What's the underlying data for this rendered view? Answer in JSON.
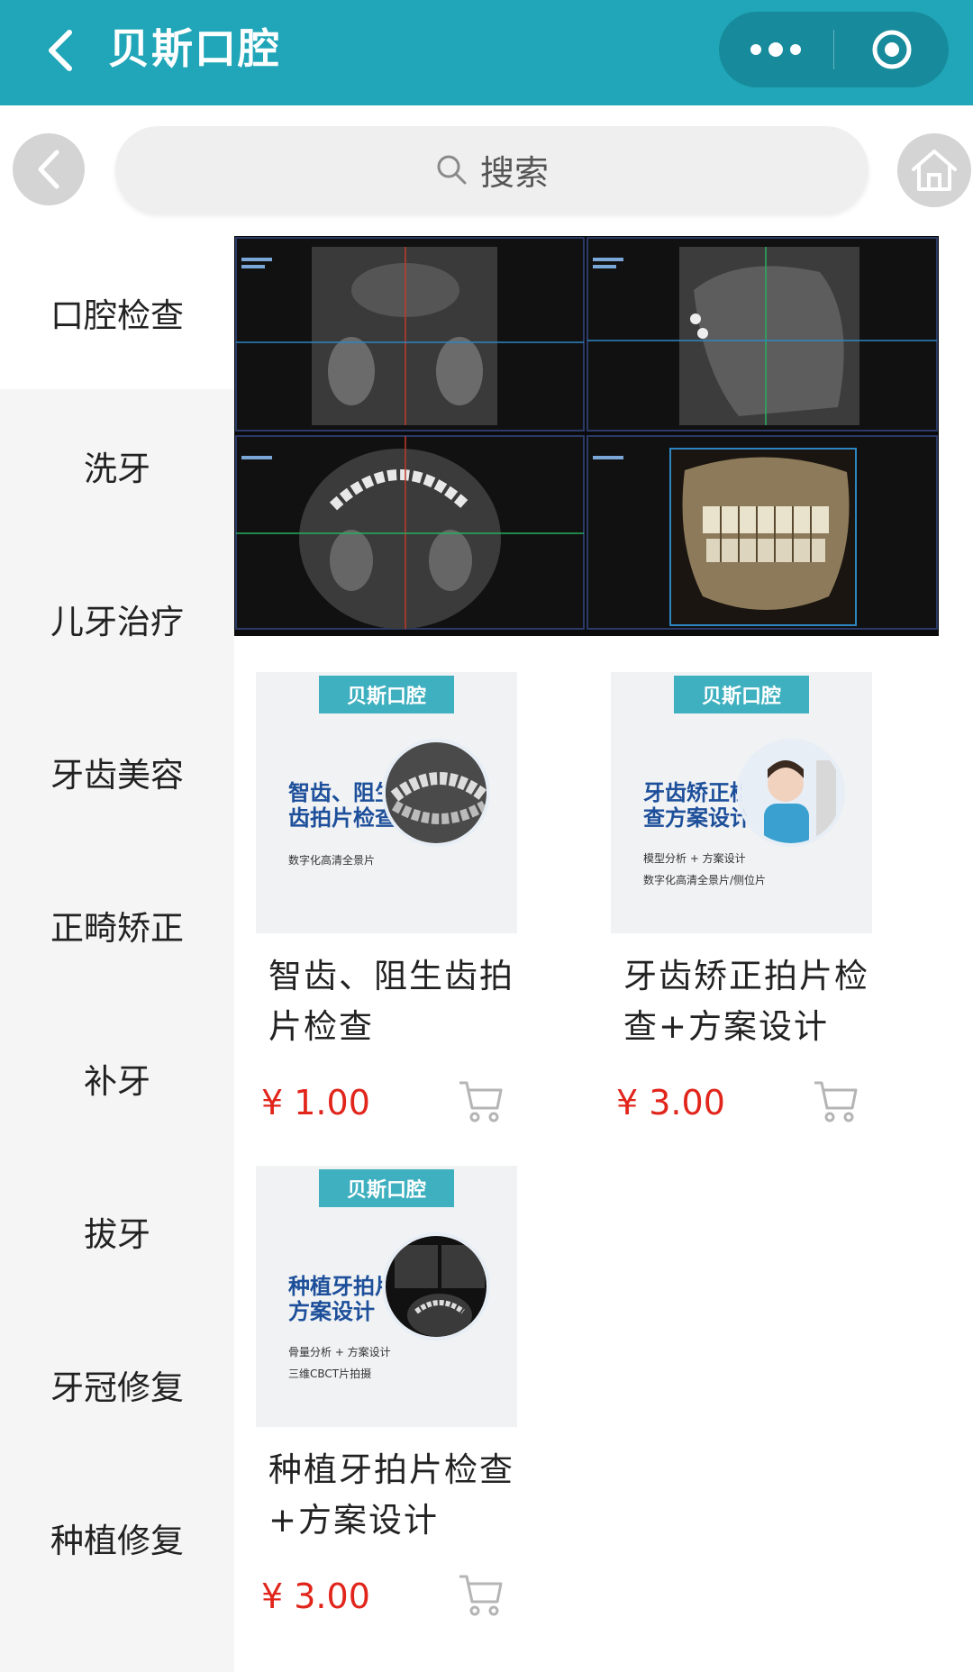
{
  "header": {
    "title": "贝斯口腔"
  },
  "search": {
    "placeholder": "搜索"
  },
  "sidebar": {
    "items": [
      {
        "label": "口腔检查",
        "active": true
      },
      {
        "label": "洗牙"
      },
      {
        "label": "儿牙治疗"
      },
      {
        "label": "牙齿美容"
      },
      {
        "label": "正畸矫正"
      },
      {
        "label": "补牙"
      },
      {
        "label": "拔牙"
      },
      {
        "label": "牙冠修复"
      },
      {
        "label": "种植修复"
      }
    ]
  },
  "products": [
    {
      "name": "智齿、阻生齿拍片检查",
      "price": "¥ 1.00",
      "thumb": {
        "brand": "贝斯口腔",
        "headline": "智齿、阻生齿拍片检查",
        "checks": [
          "数字化高清全景片"
        ]
      }
    },
    {
      "name": "牙齿矫正拍片检查+方案设计",
      "price": "¥ 3.00",
      "thumb": {
        "brand": "贝斯口腔",
        "headline": "牙齿矫正检查方案设计",
        "checks": [
          "模型分析 + 方案设计",
          "数字化高清全景片/侧位片"
        ]
      }
    },
    {
      "name": "种植牙拍片检查+方案设计",
      "price": "¥ 3.00",
      "thumb": {
        "brand": "贝斯口腔",
        "headline": "种植牙拍片方案设计",
        "checks": [
          "骨量分析 + 方案设计",
          "三维CBCT片拍摄"
        ]
      }
    }
  ],
  "colors": {
    "header": "#20a6b8",
    "price": "#e1251b",
    "brand": "#3fb0bf"
  }
}
